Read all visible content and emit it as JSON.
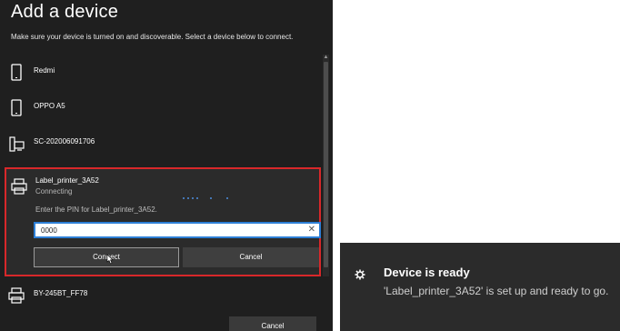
{
  "dialog": {
    "title": "Add a device",
    "subtitle": "Make sure your device is turned on and discoverable. Select a device below to connect.",
    "devices": [
      {
        "name": "Redmi",
        "icon": "phone-icon"
      },
      {
        "name": "OPPO A5",
        "icon": "phone-icon"
      },
      {
        "name": "SC-202006091706",
        "icon": "computer-icon"
      },
      {
        "name": "BY-245BT_FF78",
        "icon": "printer-icon"
      }
    ],
    "selected_device": {
      "name": "Label_printer_3A52",
      "status": "Connecting",
      "pin_prompt": "Enter the PIN for Label_printer_3A52.",
      "pin_value": "0000",
      "clear_glyph": "✕",
      "connect_label": "Connect",
      "cancel_label": "Cancel"
    },
    "cancel_label": "Cancel",
    "colors": {
      "highlight_border": "#d8282a",
      "input_border": "#2d7fd6",
      "dots": "#4f8fe0"
    }
  },
  "toast": {
    "title": "Device is ready",
    "message": "'Label_printer_3A52' is set up and ready to go.",
    "icon": "gear-icon"
  }
}
